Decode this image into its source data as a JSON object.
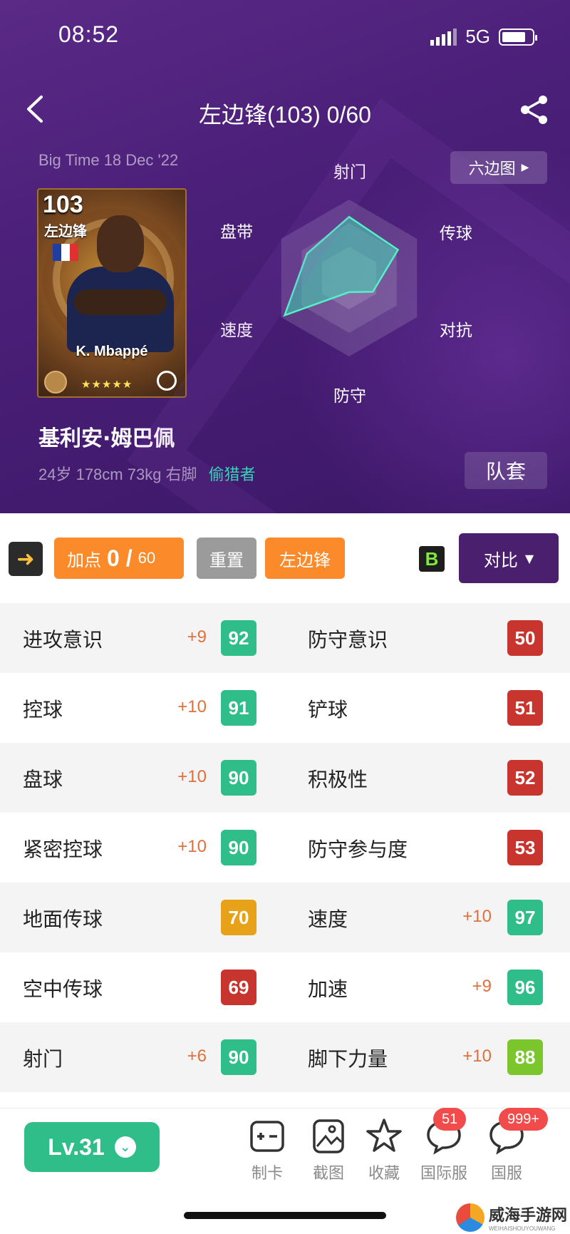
{
  "status_bar": {
    "time": "08:52",
    "network": "5G"
  },
  "nav": {
    "title": "左边锋(103)  0/60"
  },
  "hero": {
    "edition": "Big Time 18 Dec '22",
    "hex_button": "六边图",
    "card": {
      "rating": "103",
      "position": "左边锋",
      "name": "K. Mbappé",
      "stars": "★★★★★"
    },
    "player_name": "基利安·姆巴佩",
    "player_info": "24岁 178cm 73kg 右脚",
    "player_tag": "偷猎者",
    "kit_button": "队套"
  },
  "radar": {
    "labels": [
      "射门",
      "传球",
      "对抗",
      "防守",
      "速度",
      "盘带"
    ],
    "values": [
      0.78,
      0.72,
      0.35,
      0.18,
      0.95,
      0.62
    ],
    "colors": {
      "fill": "#3ed7b3",
      "stroke": "#55f0c8"
    }
  },
  "toolbar": {
    "points_label": "加点",
    "points_value": "0 /",
    "points_max": "60",
    "reset_label": "重置",
    "position_label": "左边锋",
    "badge": "B",
    "compare_label": "对比"
  },
  "stats": [
    {
      "left": {
        "name": "进攻意识",
        "bonus": "+9",
        "value": "92",
        "color": "#2fbd8a"
      },
      "right": {
        "name": "防守意识",
        "bonus": "",
        "value": "50",
        "color": "#c8352e"
      }
    },
    {
      "left": {
        "name": "控球",
        "bonus": "+10",
        "value": "91",
        "color": "#2fbd8a"
      },
      "right": {
        "name": "铲球",
        "bonus": "",
        "value": "51",
        "color": "#c8352e"
      }
    },
    {
      "left": {
        "name": "盘球",
        "bonus": "+10",
        "value": "90",
        "color": "#2fbd8a"
      },
      "right": {
        "name": "积极性",
        "bonus": "",
        "value": "52",
        "color": "#c8352e"
      }
    },
    {
      "left": {
        "name": "紧密控球",
        "bonus": "+10",
        "value": "90",
        "color": "#2fbd8a"
      },
      "right": {
        "name": "防守参与度",
        "bonus": "",
        "value": "53",
        "color": "#c8352e"
      }
    },
    {
      "left": {
        "name": "地面传球",
        "bonus": "",
        "value": "70",
        "color": "#e8a21a"
      },
      "right": {
        "name": "速度",
        "bonus": "+10",
        "value": "97",
        "color": "#2fbd8a"
      }
    },
    {
      "left": {
        "name": "空中传球",
        "bonus": "",
        "value": "69",
        "color": "#c8352e"
      },
      "right": {
        "name": "加速",
        "bonus": "+9",
        "value": "96",
        "color": "#2fbd8a"
      }
    },
    {
      "left": {
        "name": "射门",
        "bonus": "+6",
        "value": "90",
        "color": "#2fbd8a"
      },
      "right": {
        "name": "脚下力量",
        "bonus": "+10",
        "value": "88",
        "color": "#7bc62d"
      }
    }
  ],
  "bottom": {
    "level": "Lv.31",
    "tabs": [
      {
        "label": "制卡",
        "icon": "make-card-icon",
        "badge": ""
      },
      {
        "label": "截图",
        "icon": "screenshot-icon",
        "badge": ""
      },
      {
        "label": "收藏",
        "icon": "star-icon",
        "badge": ""
      },
      {
        "label": "国际服",
        "icon": "chat-icon",
        "badge": "51"
      },
      {
        "label": "国服",
        "icon": "chat-icon",
        "badge": "999+"
      }
    ]
  },
  "watermark": {
    "title": "威海手游网",
    "subtitle": "WEIHAISHOUYOUWANG"
  }
}
